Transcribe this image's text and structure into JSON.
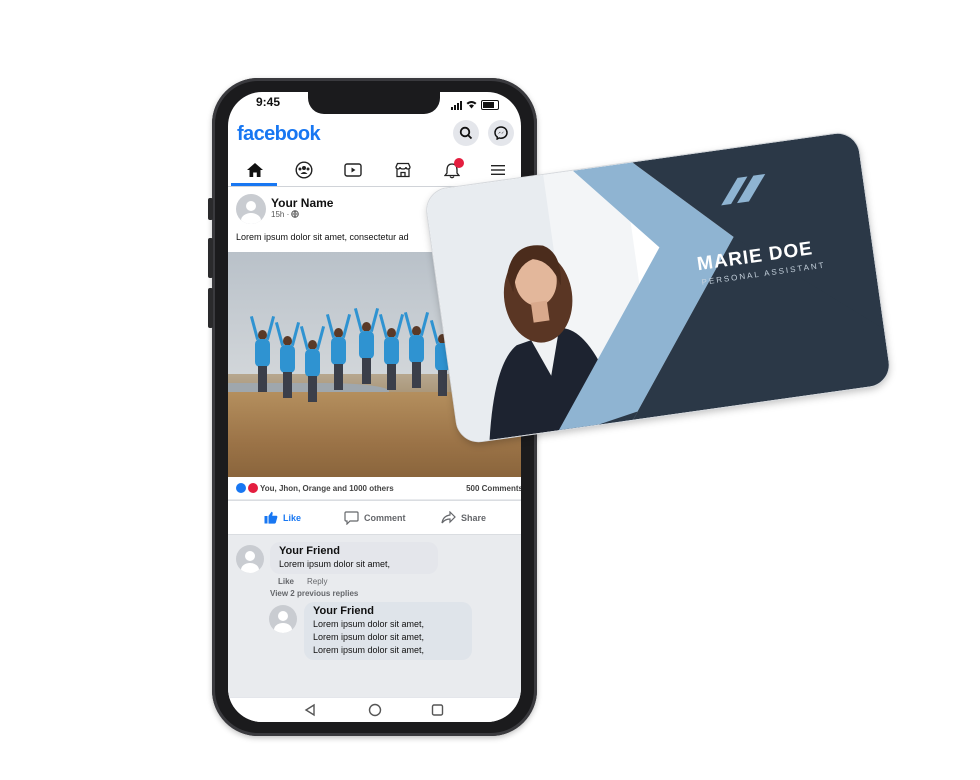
{
  "status_bar": {
    "time": "9:45"
  },
  "app": {
    "logo": "facebook",
    "brand_color": "#1877f2"
  },
  "header_icons": [
    "search-icon",
    "messenger-icon"
  ],
  "nav_icons": [
    "home-icon",
    "groups-icon",
    "watch-icon",
    "marketplace-icon",
    "notifications-icon",
    "menu-icon"
  ],
  "notification_badge": "",
  "post": {
    "author": "Your Name",
    "time": "15h ·",
    "text": "Lorem ipsum dolor sit amet, consectetur ad",
    "reactions_text": "You, Jhon, Orange and 1000 others",
    "comments_count": "500 Comments"
  },
  "actions": {
    "like": "Like",
    "comment": "Comment",
    "share": "Share"
  },
  "comment": {
    "name": "Your Friend",
    "text": "Lorem ipsum dolor sit amet,",
    "like": "Like",
    "reply": "Reply",
    "view_replies": "View 2 previous replies"
  },
  "reply": {
    "name": "Your Friend",
    "lines": [
      "Lorem ipsum dolor sit amet,",
      "Lorem ipsum dolor sit amet,",
      "Lorem ipsum dolor sit amet,"
    ]
  },
  "card": {
    "name": "MARIE DOE",
    "title": "PERSONAL ASSISTANT",
    "dark_color": "#2b3847",
    "accent_color": "#8fb4d2"
  }
}
